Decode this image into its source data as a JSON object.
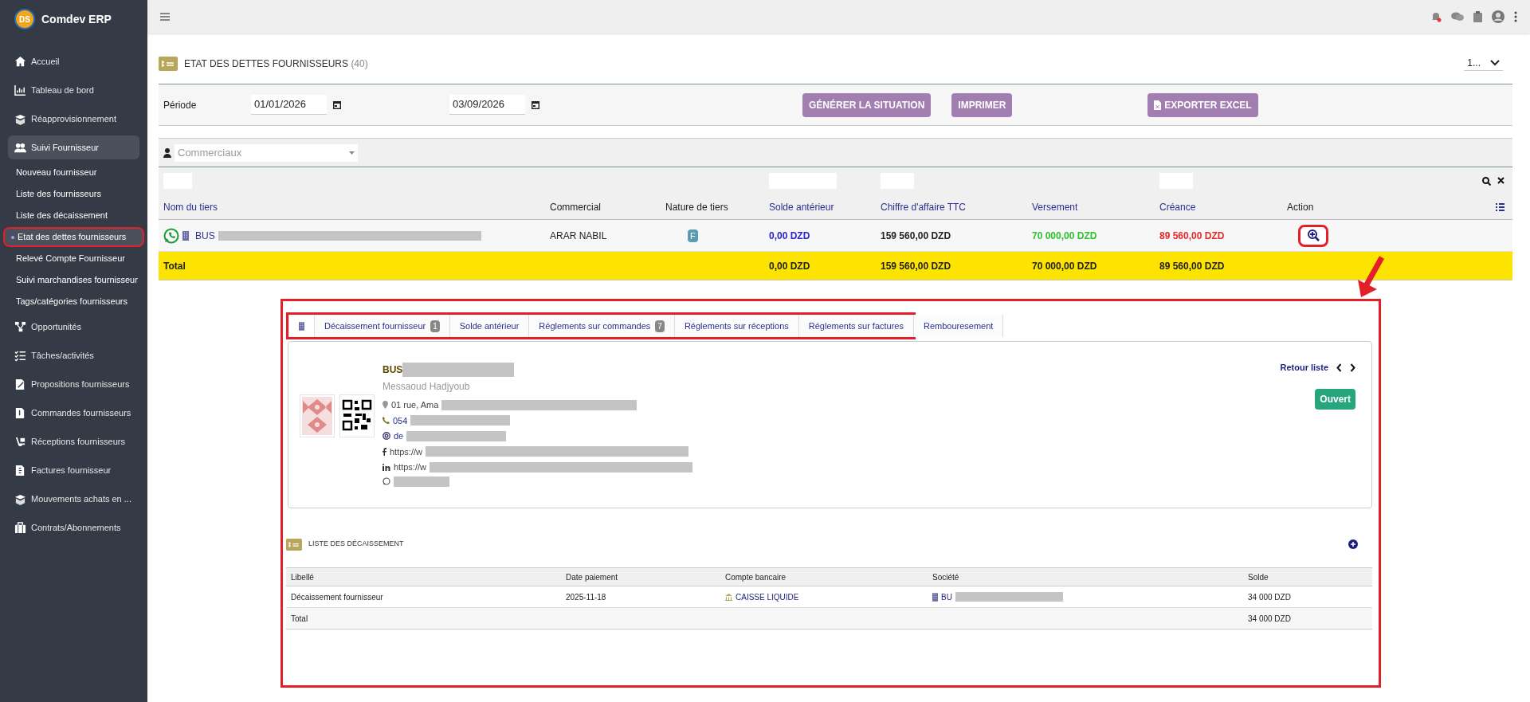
{
  "brand": {
    "logo": "DS",
    "name": "Comdev ERP"
  },
  "sidebar": {
    "items": [
      {
        "label": "Accueil",
        "selected": false
      },
      {
        "label": "Tableau de bord",
        "selected": false
      },
      {
        "label": "Réapprovisionnement",
        "selected": false
      },
      {
        "label": "Suivi Fournisseur",
        "selected": true,
        "expanded": true,
        "children": [
          {
            "label": "Nouveau fournisseur",
            "selected": false
          },
          {
            "label": "Liste des fournisseurs",
            "selected": false
          },
          {
            "label": "Liste des décaissement",
            "selected": false
          },
          {
            "label": "Etat des dettes fournisseurs",
            "selected": true
          },
          {
            "label": "Relevé Compte Fournisseur",
            "selected": false
          },
          {
            "label": "Suivi marchandises fournisseur",
            "selected": false
          },
          {
            "label": "Tags/catégories fournisseurs",
            "selected": false
          }
        ]
      },
      {
        "label": "Opportunités",
        "selected": false
      },
      {
        "label": "Tâches/activités",
        "selected": false
      },
      {
        "label": "Propositions fournisseurs",
        "selected": false
      },
      {
        "label": "Commandes fournisseurs",
        "selected": false
      },
      {
        "label": "Réceptions fournisseurs",
        "selected": false
      },
      {
        "label": "Factures fournisseur",
        "selected": false
      },
      {
        "label": "Mouvements achats en ...",
        "selected": false
      },
      {
        "label": "Contrats/Abonnements",
        "selected": false
      }
    ]
  },
  "page": {
    "title": "ETAT DES DETTES FOURNISSEURS",
    "count": "(40)",
    "page_size": "1..."
  },
  "period": {
    "label": "Période",
    "from": "01/01/2026",
    "to": "03/09/2026"
  },
  "buttons": [
    {
      "label": "GÉNÉRER LA SITUATION",
      "kind": "text"
    },
    {
      "label": "IMPRIMER",
      "kind": "text"
    },
    {
      "label": "EXPORTER EXCEL",
      "kind": "excel"
    }
  ],
  "commercial_filter": {
    "placeholder": "Commerciaux"
  },
  "table": {
    "columns": [
      "Nom du tiers",
      "Commercial",
      "Nature de tiers",
      "Solde antérieur",
      "Chiffre d'affaire TTC",
      "Versement",
      "Créance",
      "Action"
    ],
    "rows": [
      {
        "name": "BUS",
        "commercial": "ARAR NABIL",
        "nature": "F",
        "solde": "0,00 DZD",
        "chiffre": "159 560,00 DZD",
        "versement": "70 000,00 DZD",
        "creance": "89 560,00 DZD"
      }
    ],
    "total": {
      "label": "Total",
      "solde": "0,00 DZD",
      "chiffre": "159 560,00 DZD",
      "versement": "70 000,00 DZD",
      "creance": "89 560,00 DZD"
    }
  },
  "detail": {
    "tabs": [
      {
        "kind": "icon",
        "selected": true
      },
      {
        "kind": "text",
        "label": "Décaissement fournisseur",
        "badge": "1",
        "selected": false
      },
      {
        "kind": "text",
        "label": "Solde antérieur",
        "selected": false
      },
      {
        "kind": "text",
        "label": "Réglements sur commandes",
        "badge": "7",
        "selected": false
      },
      {
        "kind": "text",
        "label": "Réglements sur réceptions",
        "selected": false
      },
      {
        "kind": "text",
        "label": "Réglements sur factures",
        "selected": false
      },
      {
        "kind": "text",
        "label": "Rembouresement",
        "selected": false
      }
    ],
    "card": {
      "name": "BUS",
      "contact": "Messaoud Hadjyoub",
      "address": "01 rue, Ama",
      "phone": "054",
      "email": "de",
      "facebook": "https://w",
      "linkedin": "https://w",
      "back": "Retour liste",
      "status": "Ouvert"
    },
    "list": {
      "title": "LISTE DES DÉCAISSEMENT",
      "columns": [
        "Libellé",
        "Date paiement",
        "Compte bancaire",
        "Société",
        "Solde"
      ],
      "rows": [
        {
          "libelle": "Décaissement fournisseur",
          "date": "2025-11-18",
          "compte": "CAISSE LIQUIDE",
          "societe": "BU",
          "solde": "34 000 DZD"
        }
      ],
      "total": {
        "label": "Total",
        "solde": "34 000 DZD"
      }
    }
  }
}
